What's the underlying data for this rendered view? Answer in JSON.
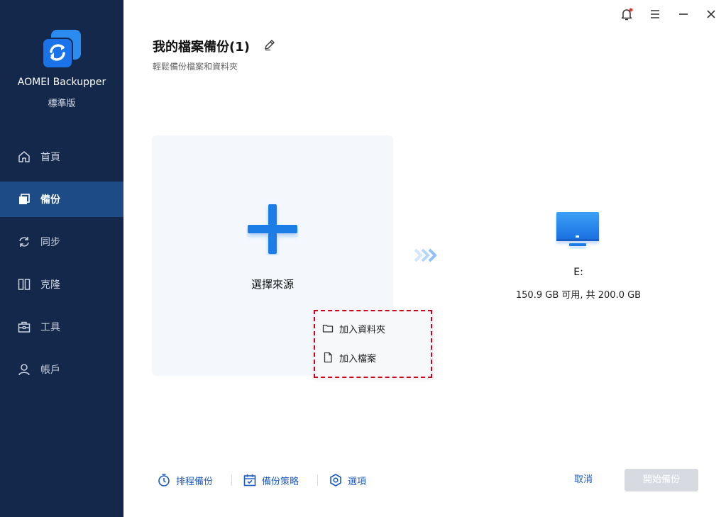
{
  "app": {
    "name": "AOMEI Backupper",
    "edition": "標準版"
  },
  "sidebar": {
    "items": [
      {
        "label": "首頁",
        "icon": "home-icon"
      },
      {
        "label": "備份",
        "icon": "backup-icon",
        "active": true
      },
      {
        "label": "同步",
        "icon": "sync-icon"
      },
      {
        "label": "克隆",
        "icon": "clone-icon"
      },
      {
        "label": "工具",
        "icon": "tools-icon"
      },
      {
        "label": "帳戶",
        "icon": "account-icon"
      }
    ]
  },
  "header": {
    "title": "我的檔案備份(1)",
    "subtitle": "輕鬆備份檔案和資料夾"
  },
  "source": {
    "label": "選擇來源"
  },
  "source_menu": {
    "items": [
      {
        "label": "加入資料夾",
        "icon": "folder-icon"
      },
      {
        "label": "加入檔案",
        "icon": "file-icon"
      }
    ]
  },
  "destination": {
    "name": "E:",
    "info": "150.9 GB 可用, 共 200.0 GB"
  },
  "footer": {
    "schedule_label": "排程備份",
    "scheme_label": "備份策略",
    "options_label": "選項",
    "cancel_label": "取消",
    "start_label": "開始備份"
  },
  "colors": {
    "sidebar_bg": "#13284a",
    "sidebar_active": "#1c4b86",
    "accent": "#1b5bbf",
    "highlight_border": "#d0021b"
  }
}
